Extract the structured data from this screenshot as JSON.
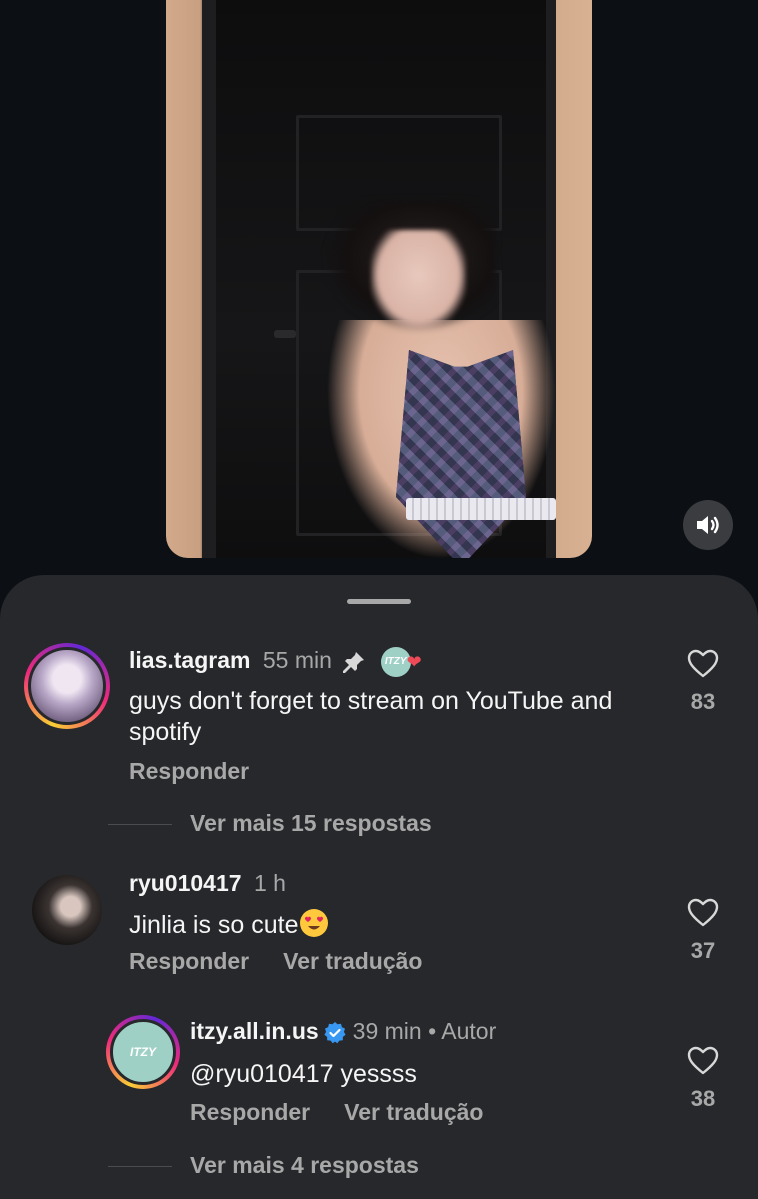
{
  "video": {
    "sound_icon": "speaker-icon"
  },
  "comments": [
    {
      "username": "lias.tagram",
      "time": "55 min",
      "pinned_icon": "pin-icon",
      "liked_by_author_badge": "ITZY",
      "text": "guys don't forget to stream on YouTube and spotify",
      "likes": "83",
      "reply_label": "Responder",
      "more_replies": "Ver mais 15 respostas"
    },
    {
      "username": "ryu010417",
      "time": "1 h",
      "text": "Jinlia is so cute",
      "likes": "37",
      "reply_label": "Responder",
      "translate_label": "Ver tradução"
    },
    {
      "username": "itzy.all.in.us",
      "time": "39 min",
      "author_label": "• Autor",
      "avatar_text": "ITZY",
      "text": "@ryu010417 yessss",
      "likes": "38",
      "reply_label": "Responder",
      "translate_label": "Ver tradução",
      "more_replies": "Ver mais 4 respostas"
    }
  ],
  "colors": {
    "background": "#0c1014",
    "sheet": "#26282b",
    "secondary_text": "#a8a8a8",
    "verified": "#3897f0",
    "like_red": "#ed4956"
  }
}
